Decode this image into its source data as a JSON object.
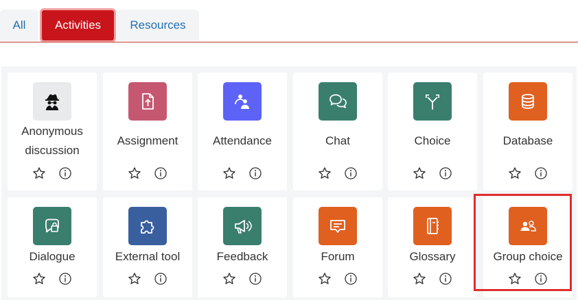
{
  "tabs": [
    {
      "label": "All"
    },
    {
      "label": "Activities"
    },
    {
      "label": "Resources"
    }
  ],
  "active_tab": "Activities",
  "colors": {
    "gray": "#e9eaeb",
    "pink": "#c55870",
    "violet": "#5d63f6",
    "teal": "#3a7e6e",
    "orange": "#e06020",
    "navy": "#3a5f9f",
    "highlight": "#e02b2b",
    "active_tab": "#c8151c"
  },
  "activities": [
    {
      "label": "Anonymous discussion",
      "line1": "Anonymous",
      "line2": "discussion",
      "icon": "spy-icon",
      "color": "gray"
    },
    {
      "label": "Assignment",
      "icon": "upload-file-icon",
      "color": "pink"
    },
    {
      "label": "Attendance",
      "icon": "people-icon",
      "color": "violet"
    },
    {
      "label": "Chat",
      "icon": "chat-bubbles-icon",
      "color": "teal"
    },
    {
      "label": "Choice",
      "icon": "split-arrow-icon",
      "color": "teal"
    },
    {
      "label": "Database",
      "icon": "database-icon",
      "color": "orange"
    },
    {
      "label": "Dialogue",
      "icon": "dialogue-lock-icon",
      "color": "teal"
    },
    {
      "label": "External tool",
      "icon": "puzzle-icon",
      "color": "navy"
    },
    {
      "label": "Feedback",
      "icon": "megaphone-icon",
      "color": "teal"
    },
    {
      "label": "Forum",
      "icon": "forum-icon",
      "color": "orange"
    },
    {
      "label": "Glossary",
      "icon": "book-icon",
      "color": "orange"
    },
    {
      "label": "Group choice",
      "icon": "group-icon",
      "color": "orange"
    }
  ],
  "card_actions": {
    "star": "star-icon",
    "info": "info-icon"
  },
  "highlighted_item": "Group choice"
}
